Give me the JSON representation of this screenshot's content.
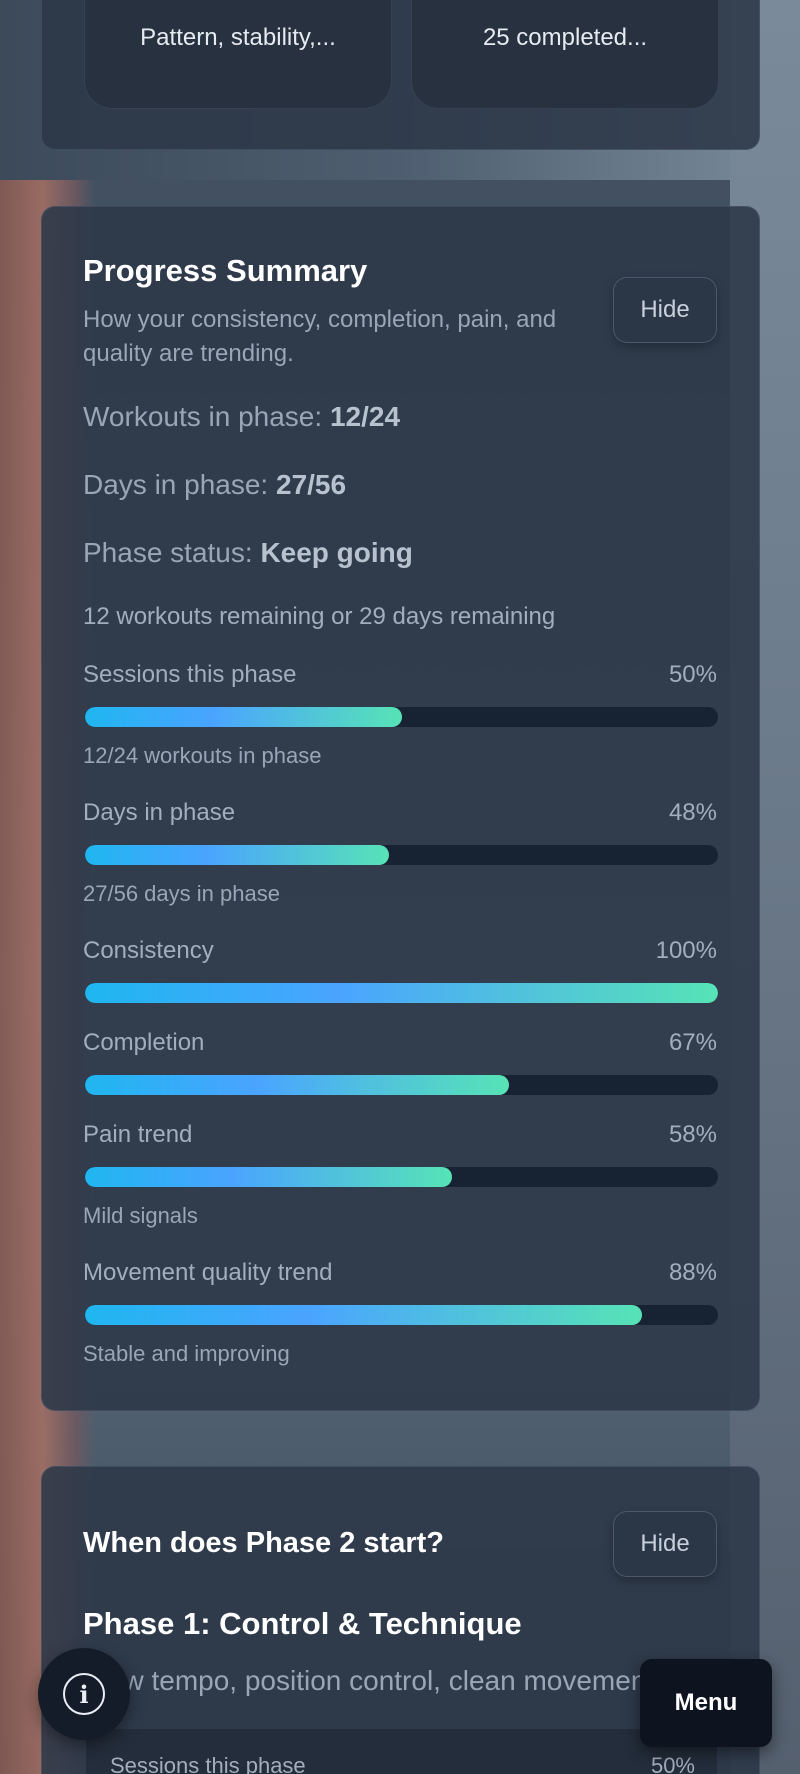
{
  "top_cards": [
    {
      "text": "Pattern, stability,..."
    },
    {
      "text": "25 completed..."
    }
  ],
  "progress": {
    "title": "Progress Summary",
    "subtitle": "How your consistency, completion, pain, and quality are trending.",
    "hide_label": "Hide",
    "workouts_label": "Workouts in phase:",
    "workouts_value": "12/24",
    "days_label": "Days in phase:",
    "days_value": "27/56",
    "status_label": "Phase status:",
    "status_value": "Keep going",
    "remaining": "12 workouts remaining or 29 days remaining",
    "metrics": [
      {
        "label": "Sessions this phase",
        "pct_text": "50%",
        "pct": 50,
        "note": "12/24 workouts in phase"
      },
      {
        "label": "Days in phase",
        "pct_text": "48%",
        "pct": 48,
        "note": "27/56 days in phase"
      },
      {
        "label": "Consistency",
        "pct_text": "100%",
        "pct": 100,
        "note": ""
      },
      {
        "label": "Completion",
        "pct_text": "67%",
        "pct": 67,
        "note": ""
      },
      {
        "label": "Pain trend",
        "pct_text": "58%",
        "pct": 58,
        "note": "Mild signals"
      },
      {
        "label": "Movement quality trend",
        "pct_text": "88%",
        "pct": 88,
        "note": "Stable and improving"
      }
    ]
  },
  "phase": {
    "question": "When does Phase 2 start?",
    "hide_label": "Hide",
    "name": "Phase 1: Control & Technique",
    "description": "Slow tempo, position control, clean movement",
    "inner_label": "Sessions this phase",
    "inner_pct": "50%"
  },
  "fab": {
    "info_glyph": "i",
    "menu_label": "Menu"
  }
}
